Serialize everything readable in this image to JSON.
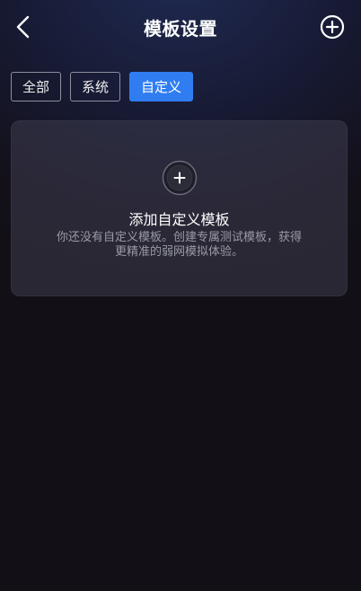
{
  "header": {
    "title": "模板设置",
    "back_icon": "chevron-left-icon",
    "add_icon": "plus-circle-icon"
  },
  "tabs": [
    {
      "label": "全部",
      "active": false
    },
    {
      "label": "系统",
      "active": false
    },
    {
      "label": "自定义",
      "active": true
    }
  ],
  "empty_card": {
    "icon": "plus-circle-icon",
    "title": "添加自定义模板",
    "description": "你还没有自定义模板。创建专属测试模板，获得更精准的弱网模拟体验。"
  },
  "colors": {
    "accent": "#2f7df1",
    "background": "#120f16",
    "text_primary": "#ffffff",
    "text_secondary": "#9a9aa6"
  }
}
